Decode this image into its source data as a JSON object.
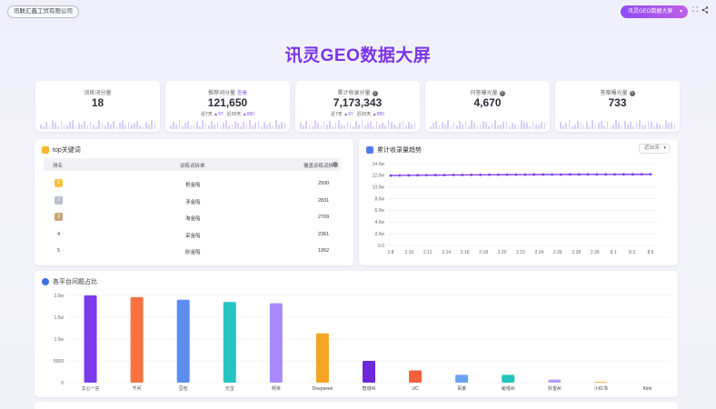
{
  "header": {
    "company": "讯联汇鑫工贸有限公司",
    "title": "讯灵GEO数据大屏",
    "switcher": "讯灵GEO数据大屏"
  },
  "icons": {
    "fullscreen": "fullscreen-icon",
    "share": "share-icon"
  },
  "stats": [
    {
      "label": "训练词分量",
      "value": "18",
      "tag": "",
      "info": false,
      "subs": null,
      "spark": [
        0.5,
        0.3,
        0.7,
        0.4,
        0.9,
        0.6,
        0.3,
        0.8,
        0.5,
        0.4,
        0.7,
        0.9,
        0.3,
        0.6,
        0.5,
        0.8,
        0.4,
        0.7,
        0.5,
        0.3,
        0.9,
        0.6,
        0.4,
        0.7,
        0.5,
        0.8,
        0.3,
        0.6,
        0.9,
        0.4,
        0.7,
        0.5,
        0.6,
        0.8,
        0.4,
        0.3,
        0.7,
        0.5,
        0.9,
        0.6
      ]
    },
    {
      "label": "推荐词分量",
      "value": "121,650",
      "tag": "查看",
      "info": false,
      "subs": {
        "l7": "近7天",
        "v7": "97",
        "l30": "近30天",
        "v30": "880"
      },
      "spark": [
        0.4,
        0.7,
        0.5,
        0.9,
        0.3,
        0.6,
        0.8,
        0.4,
        0.5,
        0.7,
        0.3,
        0.9,
        0.6,
        0.4,
        0.8,
        0.5,
        0.7,
        0.3,
        0.6,
        0.9,
        0.4,
        0.5,
        0.8,
        0.6,
        0.3,
        0.7,
        0.5,
        0.9,
        0.4,
        0.6,
        0.8,
        0.3,
        0.7,
        0.5,
        0.6,
        0.4,
        0.9,
        0.5,
        0.7,
        0.6
      ]
    },
    {
      "label": "累计收录分量",
      "value": "7,173,343",
      "tag": "",
      "info": true,
      "subs": {
        "l7": "近7天",
        "v7": "97",
        "l30": "近30天",
        "v30": "880"
      },
      "spark": [
        0.6,
        0.4,
        0.8,
        0.5,
        0.3,
        0.9,
        0.6,
        0.4,
        0.7,
        0.5,
        0.8,
        0.3,
        0.6,
        0.9,
        0.5,
        0.4,
        0.7,
        0.6,
        0.3,
        0.8,
        0.5,
        0.9,
        0.4,
        0.6,
        0.7,
        0.3,
        0.8,
        0.5,
        0.6,
        0.4,
        0.9,
        0.7,
        0.5,
        0.3,
        0.6,
        0.8,
        0.4,
        0.7,
        0.5,
        0.6
      ]
    },
    {
      "label": "问答曝光量",
      "value": "4,670",
      "tag": "",
      "info": true,
      "subs": null,
      "spark": [
        0.3,
        0.6,
        0.8,
        0.4,
        0.7,
        0.5,
        0.9,
        0.3,
        0.6,
        0.4,
        0.8,
        0.5,
        0.7,
        0.3,
        0.9,
        0.6,
        0.4,
        0.5,
        0.8,
        0.7,
        0.3,
        0.6,
        0.9,
        0.4,
        0.5,
        0.7,
        0.8,
        0.3,
        0.6,
        0.5,
        0.4,
        0.9,
        0.7,
        0.6,
        0.3,
        0.8,
        0.5,
        0.4,
        0.7,
        0.6
      ]
    },
    {
      "label": "答案曝光量",
      "value": "733",
      "tag": "",
      "info": true,
      "subs": null,
      "spark": [
        0.7,
        0.4,
        0.6,
        0.9,
        0.3,
        0.5,
        0.8,
        0.6,
        0.4,
        0.7,
        0.3,
        0.9,
        0.5,
        0.6,
        0.8,
        0.4,
        0.7,
        0.3,
        0.5,
        0.9,
        0.6,
        0.4,
        0.8,
        0.5,
        0.7,
        0.3,
        0.6,
        0.9,
        0.4,
        0.5,
        0.8,
        0.7,
        0.3,
        0.6,
        0.5,
        0.4,
        0.9,
        0.6,
        0.7,
        0.5
      ]
    }
  ],
  "topKeywords": {
    "title": "top关键词",
    "headers": [
      "排名",
      "训练词拆单",
      "覆盖训练词拆单"
    ],
    "rows": [
      {
        "rank": "1",
        "word": "抢金船",
        "count": "2930",
        "medal": "gold"
      },
      {
        "rank": "2",
        "word": "涉金船",
        "count": "2831",
        "medal": "silver"
      },
      {
        "rank": "3",
        "word": "淘金船",
        "count": "2709",
        "medal": "bronze"
      },
      {
        "rank": "4",
        "word": "采金船",
        "count": "2361",
        "medal": ""
      },
      {
        "rank": "5",
        "word": "砂金船",
        "count": "1952",
        "medal": ""
      }
    ]
  },
  "trend": {
    "title": "累计收录量趋势",
    "range": "近30天",
    "yticks": [
      "14.0w",
      "12.0w",
      "10.0w",
      "8.0w",
      "6.0w",
      "4.0w",
      "2.0w",
      "0.0"
    ],
    "xticks": [
      "2.8",
      "2.10",
      "2.12",
      "2.14",
      "2.16",
      "2.18",
      "2.20",
      "2.22",
      "2.24",
      "2.26",
      "2.28",
      "2.30",
      "8.1",
      "8.3",
      "8.5"
    ]
  },
  "platforms": {
    "title": "各平台问题占比",
    "yticks": [
      "2.0w",
      "1.5w",
      "1.0w",
      "5000",
      "0"
    ]
  },
  "chart_data": [
    {
      "type": "line",
      "title": "累计收录量趋势",
      "ylim": [
        0,
        140000
      ],
      "x": [
        "2.8",
        "2.9",
        "2.10",
        "2.11",
        "2.12",
        "2.13",
        "2.14",
        "2.15",
        "2.16",
        "2.17",
        "2.18",
        "2.19",
        "2.20",
        "2.21",
        "2.22",
        "2.23",
        "2.24",
        "2.25",
        "2.26",
        "2.27",
        "2.28",
        "2.29",
        "2.30",
        "8.1",
        "8.2",
        "8.3",
        "8.4",
        "8.5",
        "8.6",
        "8.7"
      ],
      "series": [
        {
          "values": [
            119500,
            119800,
            120000,
            120100,
            120200,
            120300,
            120400,
            120500,
            120600,
            120700,
            120800,
            120900,
            121000,
            121050,
            121100,
            121150,
            121200,
            121250,
            121300,
            121350,
            121400,
            121450,
            121500,
            121520,
            121550,
            121580,
            121600,
            121620,
            121640,
            121650
          ]
        }
      ]
    },
    {
      "type": "bar",
      "title": "各平台问题占比",
      "ylim": [
        0,
        20000
      ],
      "categories": [
        "文心一言",
        "千问",
        "豆包",
        "元宝",
        "柯米",
        "Deepseek",
        "智谱AI",
        "UC",
        "百家",
        "秘塔AI",
        "抖音AI",
        "小红书",
        "Kimi"
      ],
      "values": [
        20000,
        19600,
        19000,
        18500,
        18200,
        11300,
        5000,
        2800,
        1800,
        1800,
        700,
        200,
        0
      ],
      "colors": [
        "#7c3aed",
        "#f97342",
        "#5b8def",
        "#22c5c0",
        "#a78bfa",
        "#f5a524",
        "#6d28d9",
        "#f0623a",
        "#6aa2f5",
        "#1ec5b8",
        "#b79df5",
        "#f4b453",
        "#cccccc"
      ]
    }
  ]
}
